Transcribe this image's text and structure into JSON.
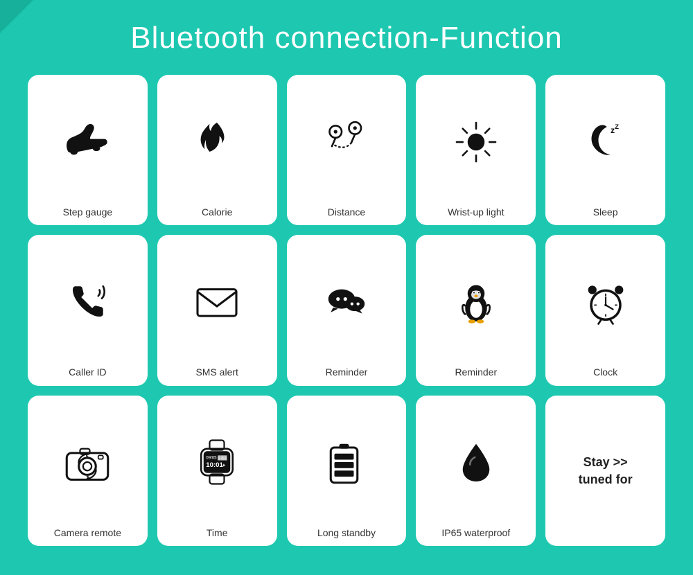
{
  "page": {
    "title": "Bluetooth connection-Function",
    "background_color": "#1ec8b0"
  },
  "cards": [
    {
      "id": "step-gauge",
      "label": "Step gauge",
      "icon_type": "shoe"
    },
    {
      "id": "calorie",
      "label": "Calorie",
      "icon_type": "flame"
    },
    {
      "id": "distance",
      "label": "Distance",
      "icon_type": "distance"
    },
    {
      "id": "wrist-up-light",
      "label": "Wrist-up light",
      "icon_type": "sun"
    },
    {
      "id": "sleep",
      "label": "Sleep",
      "icon_type": "sleep"
    },
    {
      "id": "caller-id",
      "label": "Caller ID",
      "icon_type": "phone"
    },
    {
      "id": "sms-alert",
      "label": "SMS alert",
      "icon_type": "envelope"
    },
    {
      "id": "reminder-wechat",
      "label": "Reminder",
      "icon_type": "wechat"
    },
    {
      "id": "reminder-qq",
      "label": "Reminder",
      "icon_type": "penguin"
    },
    {
      "id": "clock",
      "label": "Clock",
      "icon_type": "alarm-clock"
    },
    {
      "id": "camera-remote",
      "label": "Camera remote",
      "icon_type": "camera"
    },
    {
      "id": "time",
      "label": "Time",
      "icon_type": "smartwatch"
    },
    {
      "id": "long-standby",
      "label": "Long standby",
      "icon_type": "battery"
    },
    {
      "id": "ip65-waterproof",
      "label": "IP65  waterproof",
      "icon_type": "drop"
    },
    {
      "id": "stay-tuned",
      "label": "Stay >> tuned for",
      "icon_type": "text"
    }
  ]
}
